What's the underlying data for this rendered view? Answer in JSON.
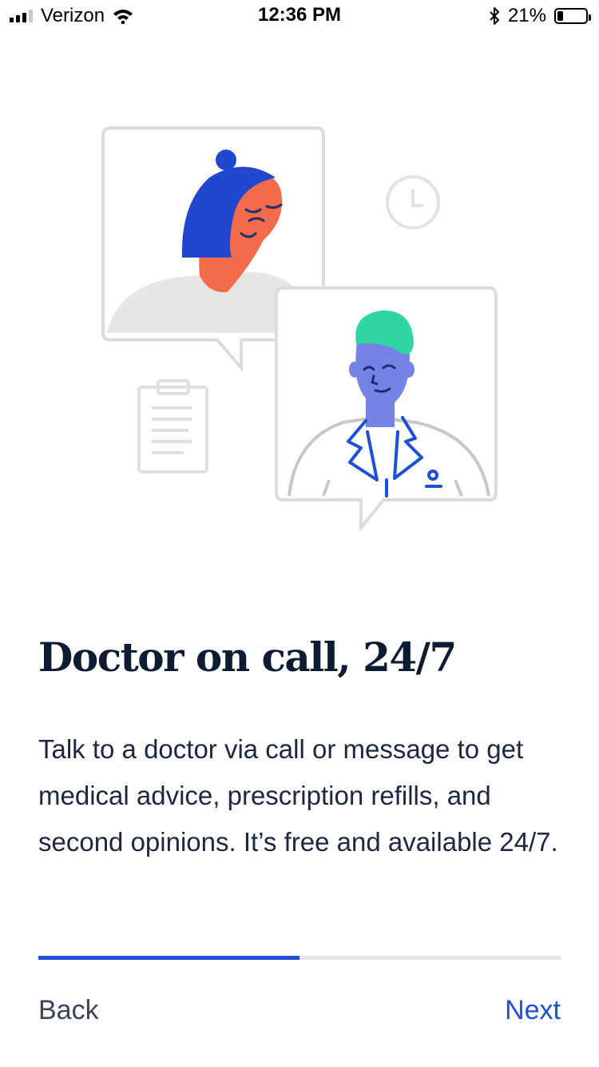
{
  "status_bar": {
    "carrier": "Verizon",
    "time": "12:36 PM",
    "battery": "21%",
    "battery_level": 0.21,
    "icons": [
      "signal-icon",
      "wifi-icon",
      "bluetooth-icon",
      "battery-icon"
    ]
  },
  "illustration": {
    "icon": "doctor-patient-video-chat-illustration"
  },
  "onboarding": {
    "title": "Doctor on call, 24/7",
    "body": "Talk to a doctor via call or message to get medical advice, prescription refills, and second opinions. It’s free and available 24/7.",
    "progress": 0.5
  },
  "nav": {
    "back": "Back",
    "next": "Next"
  },
  "colors": {
    "accent": "#1f4fd8",
    "title": "#0d1b33",
    "track": "#e2e4ea"
  }
}
